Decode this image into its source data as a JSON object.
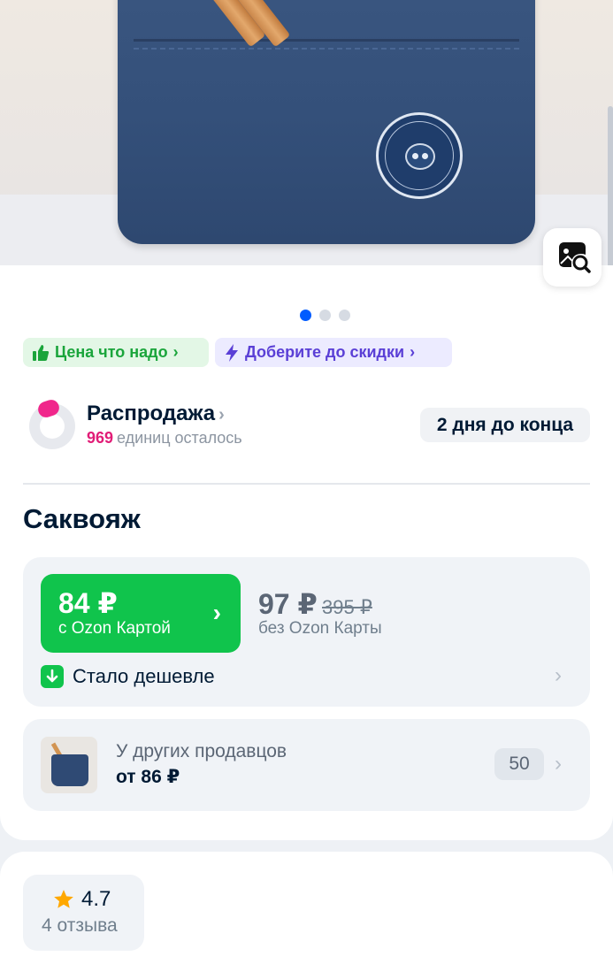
{
  "chips": {
    "price_ok": "Цена что надо",
    "add_for_discount": "Доберите до скидки"
  },
  "gallery": {
    "dots_total": 3,
    "active_index": 0
  },
  "sale": {
    "title": "Распродажа",
    "count": "969",
    "remaining_text": "единиц осталось",
    "deadline": "2 дня до конца"
  },
  "product": {
    "title": "Саквояж"
  },
  "price": {
    "ozon_card_amount": "84 ₽",
    "ozon_card_label": "с Ozon Картой",
    "regular_amount": "97 ₽",
    "old_amount": "395 ₽",
    "regular_label": "без Ozon Карты",
    "cheaper_text": "Стало дешевле"
  },
  "other_sellers": {
    "label": "У других продавцов",
    "price": "от 86 ₽",
    "count": "50"
  },
  "reviews": {
    "rating": "4.7",
    "count_text": "4 отзыва"
  },
  "colors": {
    "ozon_green": "#10c44c",
    "accent_blue": "#005bff",
    "sale_pink": "#e11d77"
  }
}
